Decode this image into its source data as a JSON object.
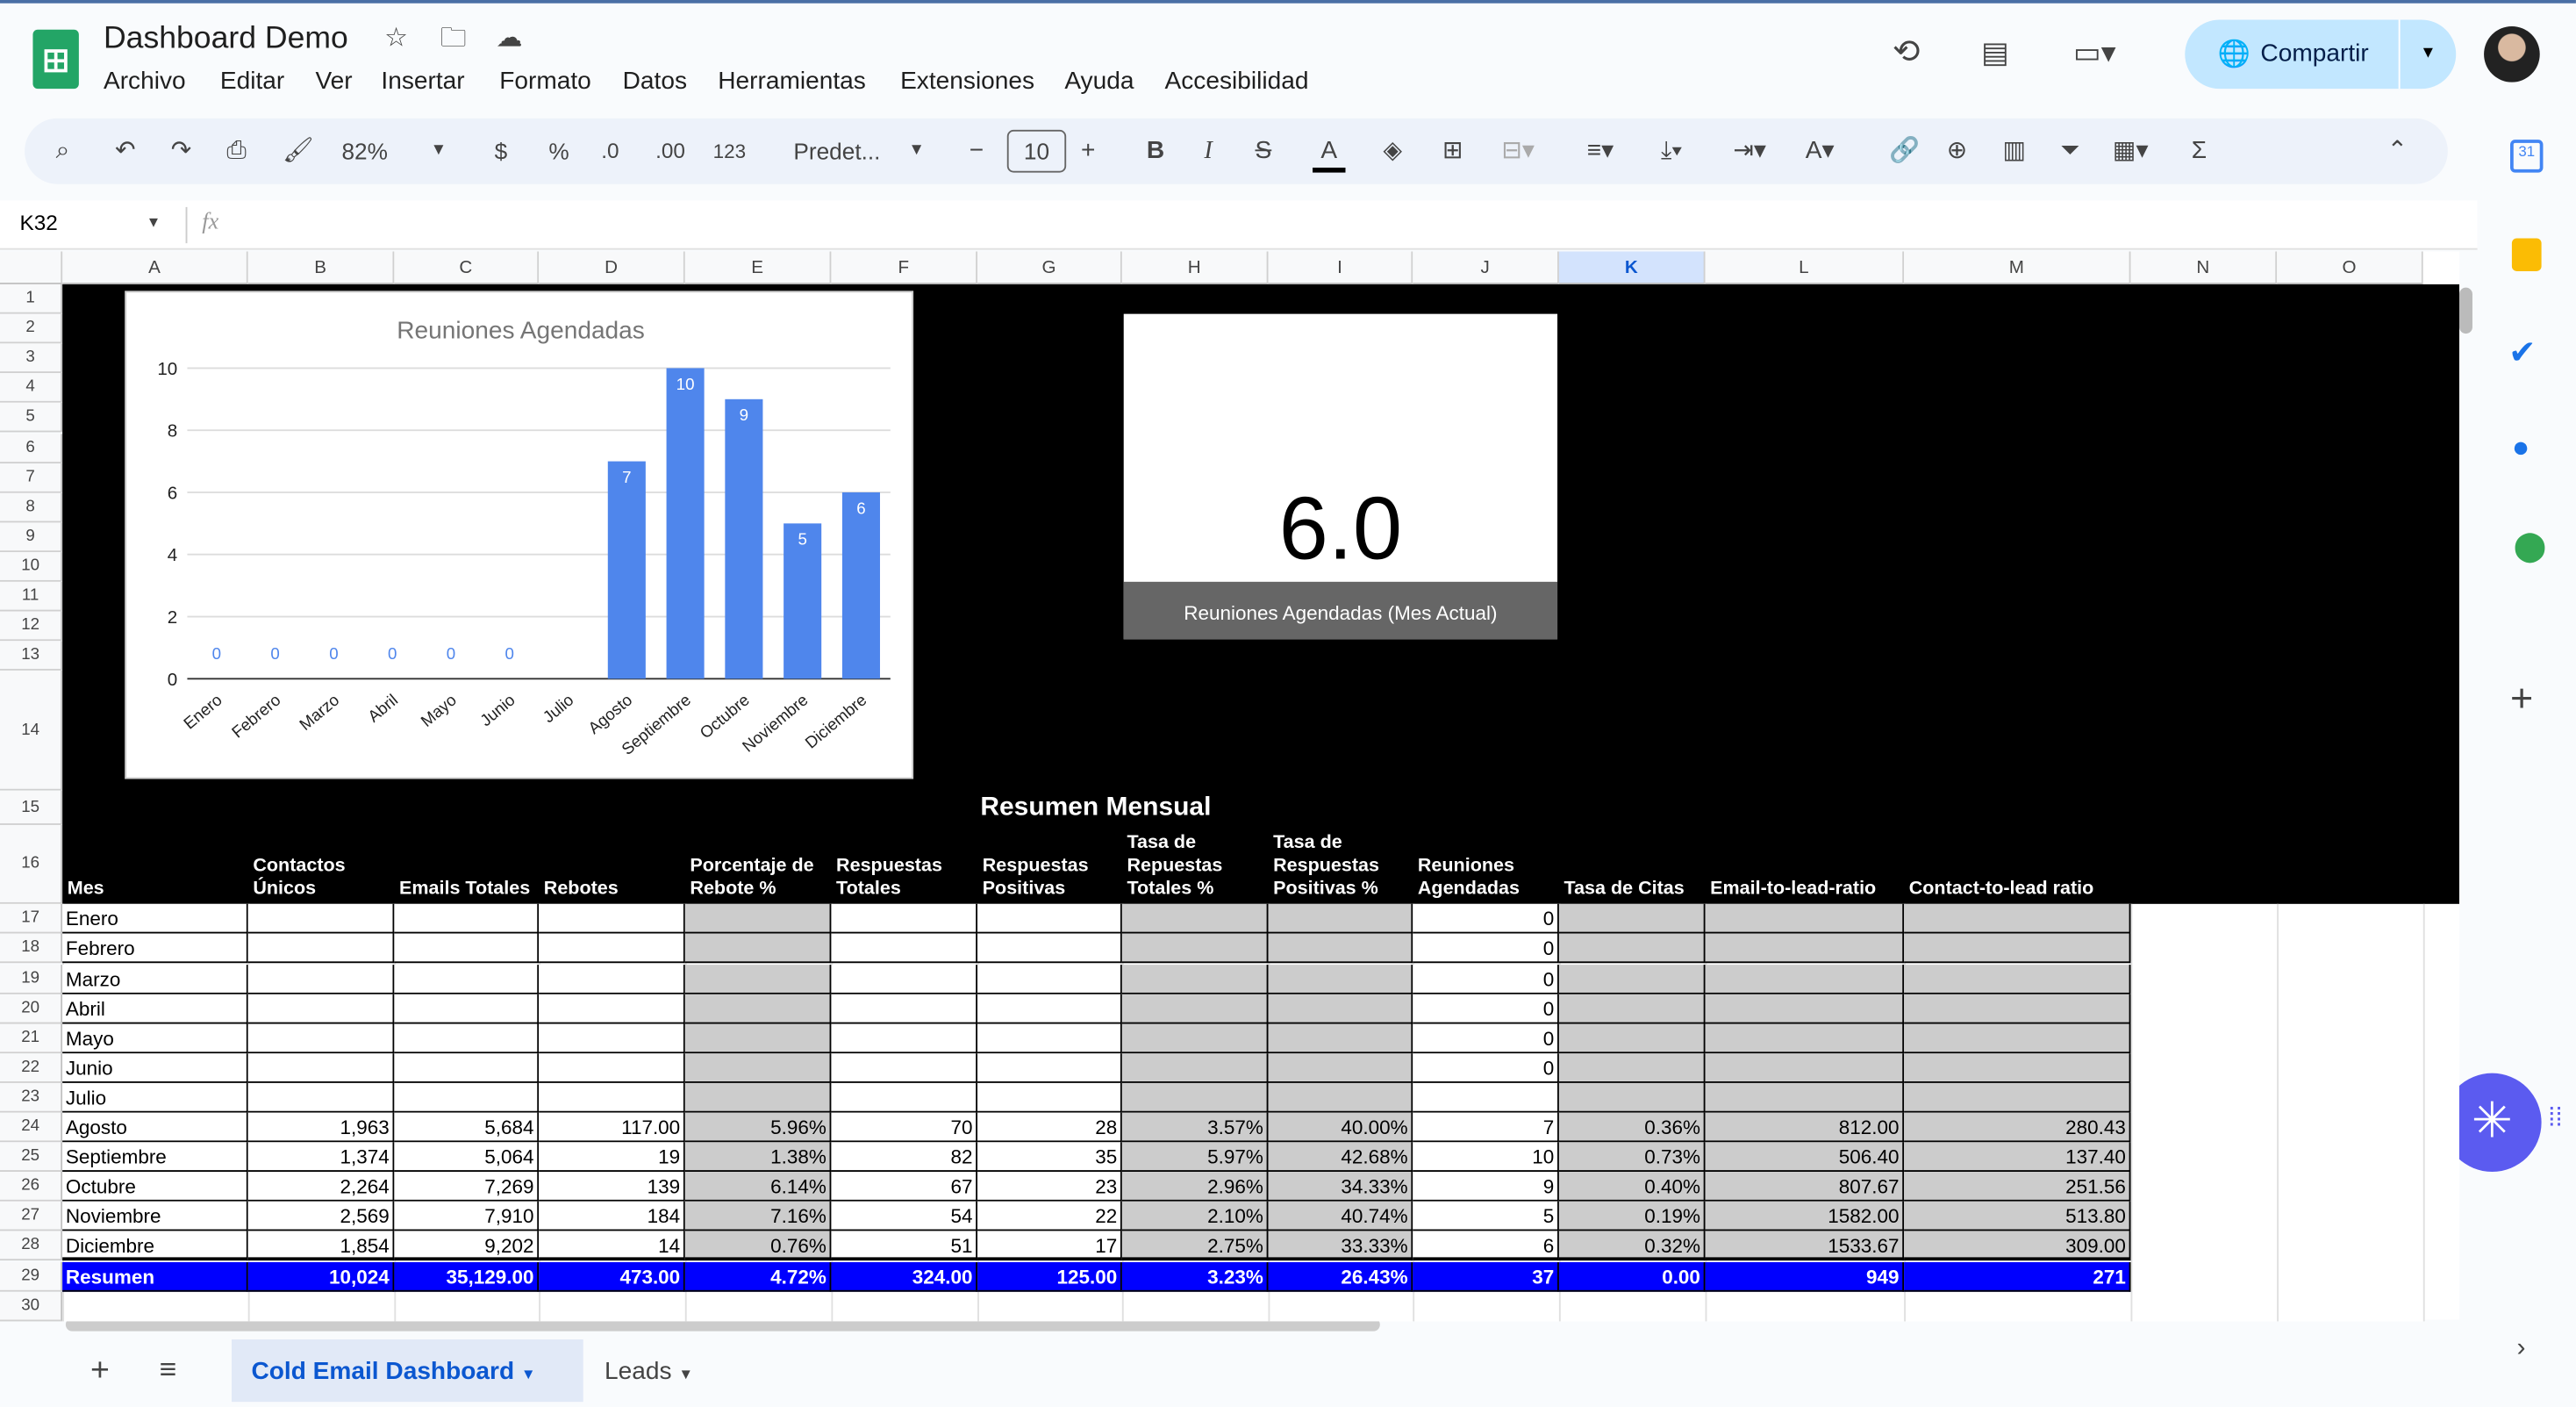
{
  "app": {
    "title": "Dashboard Demo",
    "menus": [
      "Archivo",
      "Editar",
      "Ver",
      "Insertar",
      "Formato",
      "Datos",
      "Herramientas",
      "Extensiones",
      "Ayuda",
      "Accesibilidad"
    ],
    "share_label": "Compartir"
  },
  "toolbar": {
    "zoom": "82%",
    "currency": "$",
    "percent": "%",
    "dec_less": ".0",
    "dec_more": ".00",
    "format_123": "123",
    "font": "Predet...",
    "font_size": "10",
    "bold": "B",
    "italic": "I",
    "text_color": "A"
  },
  "formula_bar": {
    "cell_ref": "K32",
    "fx": "fx",
    "value": ""
  },
  "columns": [
    "A",
    "B",
    "C",
    "D",
    "E",
    "F",
    "G",
    "H",
    "I",
    "J",
    "K",
    "L",
    "M",
    "N",
    "O"
  ],
  "selected_column": "K",
  "chart_data": {
    "type": "bar",
    "title": "Reuniones Agendadas",
    "categories": [
      "Enero",
      "Febrero",
      "Marzo",
      "Abril",
      "Mayo",
      "Junio",
      "Julio",
      "Agosto",
      "Septiembre",
      "Octubre",
      "Noviembre",
      "Diciembre"
    ],
    "values": [
      0,
      0,
      0,
      0,
      0,
      0,
      null,
      7,
      10,
      9,
      5,
      6
    ],
    "ylim": [
      0,
      10
    ],
    "yticks": [
      0,
      2,
      4,
      6,
      8,
      10
    ],
    "grid": true,
    "color": "#4f86ec"
  },
  "scorecard": {
    "value": "6.0",
    "label": "Reuniones Agendadas (Mes Actual)"
  },
  "table": {
    "title": "Resumen Mensual",
    "headers": [
      "Mes",
      "Contactos Únicos",
      "Emails Totales",
      "Rebotes",
      "Porcentaje de Rebote %",
      "Respuestas Totales",
      "Respuestas Positivas",
      "Tasa de Repuestas Totales %",
      "Tasa de Respuestas Positivas %",
      "Reuniones Agendadas",
      "Tasa de Citas",
      "Email-to-lead-ratio",
      "Contact-to-lead ratio"
    ],
    "rows": [
      [
        "Enero",
        "",
        "",
        "",
        "",
        "",
        "",
        "",
        "",
        "0",
        "",
        "",
        ""
      ],
      [
        "Febrero",
        "",
        "",
        "",
        "",
        "",
        "",
        "",
        "",
        "0",
        "",
        "",
        ""
      ],
      [
        "Marzo",
        "",
        "",
        "",
        "",
        "",
        "",
        "",
        "",
        "0",
        "",
        "",
        ""
      ],
      [
        "Abril",
        "",
        "",
        "",
        "",
        "",
        "",
        "",
        "",
        "0",
        "",
        "",
        ""
      ],
      [
        "Mayo",
        "",
        "",
        "",
        "",
        "",
        "",
        "",
        "",
        "0",
        "",
        "",
        ""
      ],
      [
        "Junio",
        "",
        "",
        "",
        "",
        "",
        "",
        "",
        "",
        "0",
        "",
        "",
        ""
      ],
      [
        "Julio",
        "",
        "",
        "",
        "",
        "",
        "",
        "",
        "",
        "",
        "",
        "",
        ""
      ],
      [
        "Agosto",
        "1,963",
        "5,684",
        "117.00",
        "5.96%",
        "70",
        "28",
        "3.57%",
        "40.00%",
        "7",
        "0.36%",
        "812.00",
        "280.43"
      ],
      [
        "Septiembre",
        "1,374",
        "5,064",
        "19",
        "1.38%",
        "82",
        "35",
        "5.97%",
        "42.68%",
        "10",
        "0.73%",
        "506.40",
        "137.40"
      ],
      [
        "Octubre",
        "2,264",
        "7,269",
        "139",
        "6.14%",
        "67",
        "23",
        "2.96%",
        "34.33%",
        "9",
        "0.40%",
        "807.67",
        "251.56"
      ],
      [
        "Noviembre",
        "2,569",
        "7,910",
        "184",
        "7.16%",
        "54",
        "22",
        "2.10%",
        "40.74%",
        "5",
        "0.19%",
        "1582.00",
        "513.80"
      ],
      [
        "Diciembre",
        "1,854",
        "9,202",
        "14",
        "0.76%",
        "51",
        "17",
        "2.75%",
        "33.33%",
        "6",
        "0.32%",
        "1533.67",
        "309.00"
      ]
    ],
    "summary": [
      "Resumen",
      "10,024",
      "35,129.00",
      "473.00",
      "4.72%",
      "324.00",
      "125.00",
      "3.23%",
      "26.43%",
      "37",
      "0.00",
      "949",
      "271"
    ],
    "summary_color": "#0000ff",
    "shaded_color": "#cccccc"
  },
  "sheets": [
    {
      "label": "Cold Email Dashboard",
      "active": true
    },
    {
      "label": "Leads",
      "active": false
    }
  ]
}
